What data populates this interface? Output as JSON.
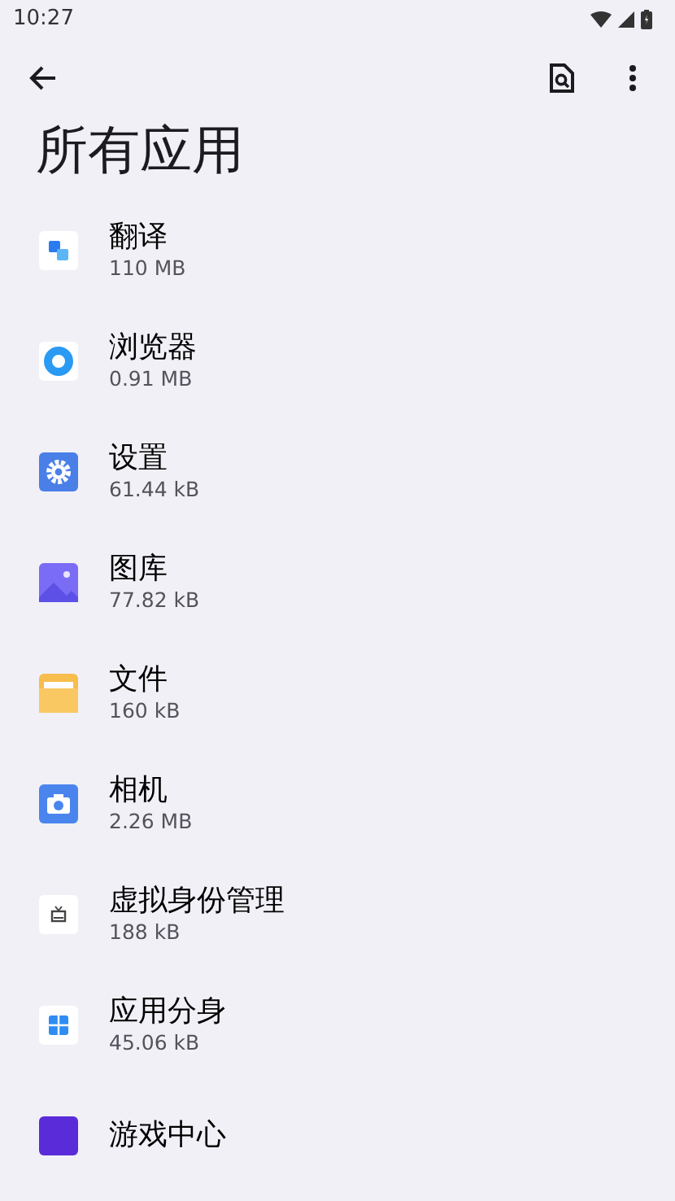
{
  "status_bar": {
    "time": "10:27"
  },
  "title": "所有应用",
  "apps": [
    {
      "name": "翻译",
      "size": "110 MB",
      "kind": "translate"
    },
    {
      "name": "浏览器",
      "size": "0.91 MB",
      "kind": "browser"
    },
    {
      "name": "设置",
      "size": "61.44 kB",
      "kind": "settings"
    },
    {
      "name": "图库",
      "size": "77.82 kB",
      "kind": "gallery"
    },
    {
      "name": "文件",
      "size": "160 kB",
      "kind": "files"
    },
    {
      "name": "相机",
      "size": "2.26 MB",
      "kind": "camera"
    },
    {
      "name": "虚拟身份管理",
      "size": "188 kB",
      "kind": "tv"
    },
    {
      "name": "应用分身",
      "size": "45.06 kB",
      "kind": "grid"
    },
    {
      "name": "游戏中心",
      "kind": "game"
    }
  ]
}
